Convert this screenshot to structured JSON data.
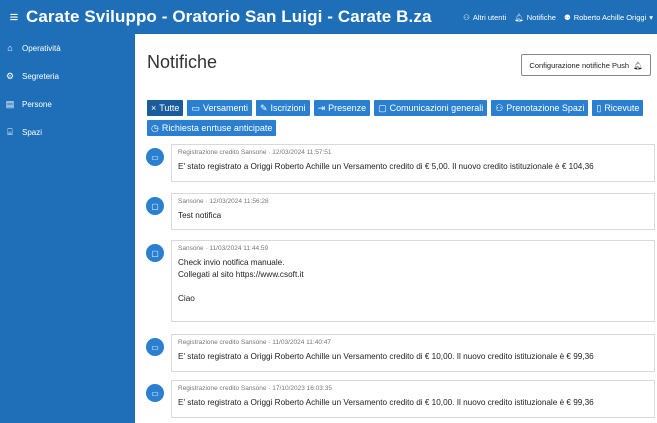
{
  "header": {
    "title": "Carate Sviluppo - Oratorio San Luigi - Carate B.za",
    "actions": [
      {
        "label": "Altri utenti",
        "icon": "users-icon"
      },
      {
        "label": "Notifiche",
        "icon": "bell-icon"
      },
      {
        "label": "Roberto Achille Origgi",
        "icon": "user-icon",
        "caret": "▾"
      }
    ]
  },
  "sidebar": {
    "items": [
      {
        "label": "Operatività",
        "icon": "home-icon"
      },
      {
        "label": "Segreteria",
        "icon": "settings-icon"
      },
      {
        "label": "Persone",
        "icon": "id-card-icon"
      },
      {
        "label": "Spazi",
        "icon": "building-icon"
      }
    ]
  },
  "main": {
    "title": "Notifiche",
    "push_button": "Configurazione notifiche Push",
    "filters": [
      {
        "label": "Tutte",
        "icon": "close-icon",
        "active": true
      },
      {
        "label": "Versamenti",
        "icon": "money-icon"
      },
      {
        "label": "Iscrizioni",
        "icon": "edit-icon"
      },
      {
        "label": "Presenze",
        "icon": "login-icon"
      },
      {
        "label": "Comunicazioni generali",
        "icon": "comment-icon"
      },
      {
        "label": "Prenotazione Spazi",
        "icon": "people-icon"
      },
      {
        "label": "Ricevute",
        "icon": "receipt-icon"
      },
      {
        "label": "Richiesta enrtuse anticipate",
        "icon": "clock-icon"
      }
    ],
    "notifications": [
      {
        "type": "money",
        "meta": "Registrazione credito Sansone · 12/03/2024 11:57:51",
        "lines": [
          "E' stato registrato a Origgi Roberto Achille un Versamento credito di € 5,00. Il nuovo credito istituzionale è € 104,36"
        ]
      },
      {
        "type": "chat",
        "meta": "Sansone · 12/03/2024 11:56:28",
        "lines": [
          "Test notifica"
        ]
      },
      {
        "type": "chat",
        "meta": "Sansone · 11/03/2024 11:44:59",
        "lines": [
          "Check invio notifica manuale.",
          "Collegati al sito https://www.csoft.it",
          "",
          "Ciao"
        ]
      },
      {
        "type": "money",
        "meta": "Registrazione credito Sansone · 11/03/2024 11:40:47",
        "lines": [
          "E' stato registrato a Origgi Roberto Achille un Versamento credito di € 10,00. Il nuovo credito istituzionale è € 99,36"
        ]
      },
      {
        "type": "money",
        "meta": "Registrazione credito Sansone · 17/10/2023 16:03:35",
        "lines": [
          "E' stato registrato a Origgi Roberto Achille un Versamento credito di € 10,00. Il nuovo credito istituzionale è € 99,36"
        ]
      }
    ]
  },
  "colors": {
    "primary": "#1e6fb8",
    "chip": "#2a7fd0"
  }
}
